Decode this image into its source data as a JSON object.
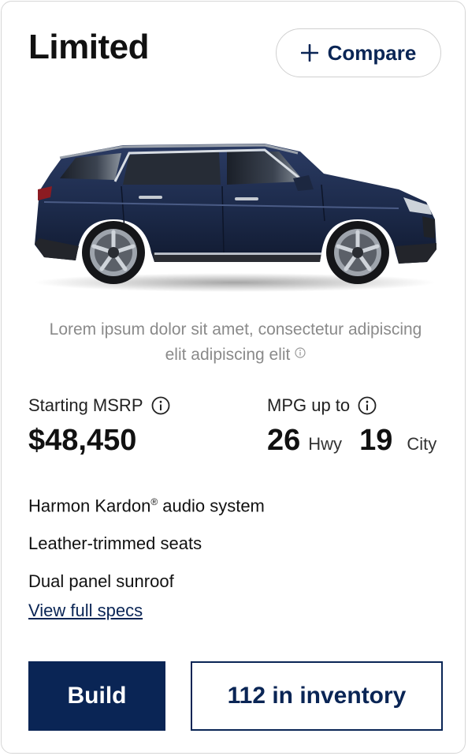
{
  "trim": {
    "name": "Limited"
  },
  "compare": {
    "label": "Compare",
    "icon": "plus-icon"
  },
  "vehicle_image": {
    "icon": "suv-image",
    "body_color": "#1c2a4a"
  },
  "disclaimer": {
    "text": "Lorem ipsum dolor sit amet, consectetur adipiscing elit adipiscing elit",
    "icon": "info-icon"
  },
  "pricing": {
    "msrp_label": "Starting MSRP",
    "msrp_value": "$48,450",
    "mpg_label": "MPG up to",
    "hwy_value": "26",
    "hwy_unit": "Hwy",
    "city_value": "19",
    "city_unit": "City"
  },
  "features": {
    "item0_name": "Harmon Kardon",
    "item0_mark": "®",
    "item0_rest": " audio system",
    "item1": "Leather-trimmed seats",
    "item2": "Dual panel sunroof"
  },
  "links": {
    "specs": "View full specs"
  },
  "actions": {
    "build": "Build",
    "inventory": "112 in inventory"
  },
  "colors": {
    "brand_navy": "#0a2555",
    "border": "#d6d6d6",
    "muted_text": "#8a8a8a"
  }
}
